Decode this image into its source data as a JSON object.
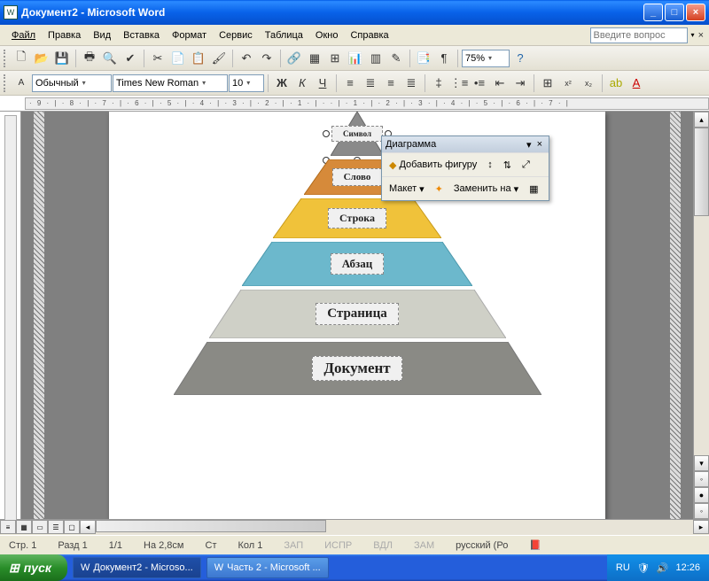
{
  "window": {
    "title": "Документ2 - Microsoft Word"
  },
  "menu": {
    "items": [
      "Файл",
      "Правка",
      "Вид",
      "Вставка",
      "Формат",
      "Сервис",
      "Таблица",
      "Окно",
      "Справка"
    ],
    "help_placeholder": "Введите вопрос"
  },
  "toolbar1": {
    "zoom": "75%"
  },
  "toolbar2": {
    "style": "Обычный",
    "font": "Times New Roman",
    "size": "10"
  },
  "ruler": {
    "text": "· 9 · | · 8 · | · 7 · | · 6 · | · 5 · | · 4 · | · 3 · | · 2 · | · 1 · | ·     · | · 1 · | · 2 · | · 3 · | · 4 · | · 5 · | · 6 · | · 7 · |"
  },
  "chart_data": {
    "type": "pyramid",
    "levels": [
      {
        "label": "Символ",
        "color": "#8a8a8a"
      },
      {
        "label": "Слово",
        "color": "#d68a3a"
      },
      {
        "label": "Строка",
        "color": "#f0c23a"
      },
      {
        "label": "Абзац",
        "color": "#6cb8cc"
      },
      {
        "label": "Страница",
        "color": "#cfd0c7"
      },
      {
        "label": "Документ",
        "color": "#8a8a85"
      }
    ]
  },
  "float_toolbar": {
    "title": "Диаграмма",
    "add_shape": "Добавить фигуру",
    "layout": "Макет",
    "replace": "Заменить на"
  },
  "status": {
    "page": "Стр. 1",
    "section": "Разд 1",
    "pages": "1/1",
    "at": "На 2,8см",
    "line": "Ст",
    "col": "Кол 1",
    "rec": "ЗАП",
    "trk": "ИСПР",
    "ext": "ВДЛ",
    "ovr": "ЗАМ",
    "lang": "русский (Ро"
  },
  "taskbar": {
    "start": "пуск",
    "tasks": [
      "Документ2 - Microso...",
      "Часть 2 - Microsoft ..."
    ],
    "tray_lang": "RU",
    "clock": "12:26"
  }
}
